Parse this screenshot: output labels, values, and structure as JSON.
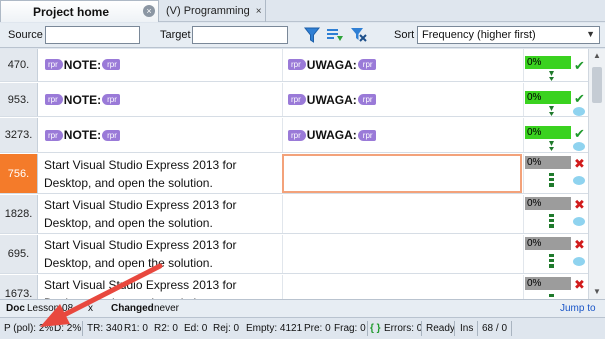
{
  "tabs": [
    {
      "label": "Project home",
      "active": true
    },
    {
      "label": "(V) Programming",
      "active": false
    }
  ],
  "toolbar": {
    "source_label": "Source",
    "source_value": "",
    "target_label": "Target",
    "target_value": "",
    "sort_label": "Sort",
    "sort_value": "Frequency (higher first)",
    "icons": [
      "filter-icon",
      "filter-options-icon",
      "clear-filter-icon"
    ]
  },
  "rows": [
    {
      "num": "470.",
      "source": {
        "tag_open": "rpr",
        "text": "NOTE:",
        "tag_close": "rpr"
      },
      "target": {
        "tag_open": "rpr",
        "text": "UWAGA:",
        "tag_close": "rpr"
      },
      "percent": "0%",
      "status": "confirmed"
    },
    {
      "num": "953.",
      "source": {
        "tag_open": "rpr",
        "text": "NOTE:",
        "tag_close": "rpr"
      },
      "target": {
        "tag_open": "rpr",
        "text": "UWAGA:",
        "tag_close": "rpr"
      },
      "percent": "0%",
      "status": "confirmed"
    },
    {
      "num": "3273.",
      "source": {
        "tag_open": "rpr",
        "text": "NOTE:",
        "tag_close": "rpr"
      },
      "target": {
        "tag_open": "rpr",
        "text": "UWAGA:",
        "tag_close": "rpr"
      },
      "percent": "0%",
      "status": "confirmed"
    },
    {
      "num": "756.",
      "source_text": "Start Visual Studio Express 2013 for Desktop, and open the solution.",
      "target_text": "",
      "percent": "0%",
      "status": "unconfirmed",
      "current": true
    },
    {
      "num": "1828.",
      "source_text": "Start Visual Studio Express 2013 for Desktop, and open the solution.",
      "target_text": "",
      "percent": "0%",
      "status": "unconfirmed"
    },
    {
      "num": "695.",
      "source_text": "Start Visual Studio Express 2013 for Desktop, and open the solution.",
      "target_text": "",
      "percent": "0%",
      "status": "unconfirmed"
    },
    {
      "num": "1673.",
      "source_text": "Start Visual Studio Express 2013 for Desktop, and open the solution.",
      "target_text": "",
      "percent": "0%",
      "status": "unconfirmed"
    }
  ],
  "infobar": {
    "doc_label": "Doc",
    "doc_value": "Lesson 08",
    "doc_suffix": "x",
    "changed_label": "Changed",
    "changed_value": "never",
    "jump_label": "Jump to"
  },
  "statusbar": {
    "p_pol": "P (pol): 2%",
    "d": "D: 2%",
    "tr": "TR: 340",
    "r1": "R1: 0",
    "r2": "R2: 0",
    "ed": "Ed: 0",
    "rej": "Rej: 0",
    "empty": "Empty: 4121",
    "pre": "Pre: 0",
    "frag": "Frag: 0",
    "braces": "{ }",
    "errors": "Errors: 0",
    "ready": "Ready",
    "ins": "Ins",
    "position": "68 / 0"
  },
  "colors": {
    "current_row": "#f47b2a",
    "progress_green": "#3ad21f",
    "progress_gray": "#9c9c9c",
    "annotation_arrow": "#e8483e",
    "tag": "#9a7ad8"
  }
}
